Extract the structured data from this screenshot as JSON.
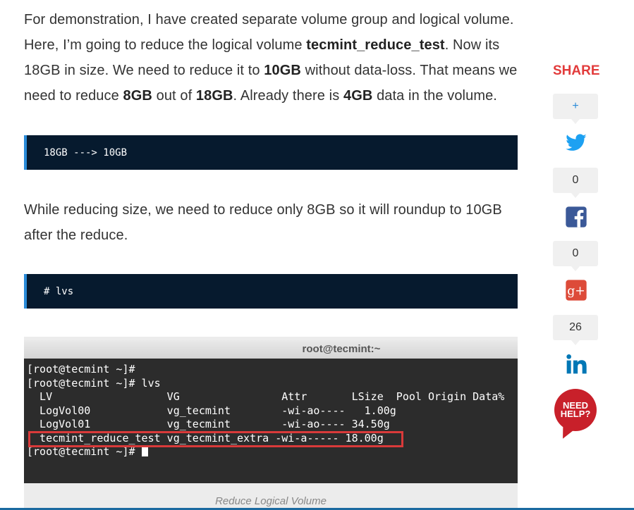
{
  "article": {
    "p1_a": "For demonstration, I have created separate volume group and logical volume. Here, I’m going to reduce the logical volume ",
    "p1_b": "tecmint_reduce_test",
    "p1_c": ". Now its 18GB in size. We need to reduce it to ",
    "p1_d": "10GB",
    "p1_e": " without data-loss. That means we need to reduce ",
    "p1_f": "8GB",
    "p1_g": " out of ",
    "p1_h": "18GB",
    "p1_i": ". Already there is ",
    "p1_j": "4GB",
    "p1_k": " data in the volume.",
    "code1": "18GB ---> 10GB",
    "p2": "While reducing size, we need to reduce only 8GB so it will roundup to 10GB after the reduce.",
    "code2": "# lvs"
  },
  "screenshot": {
    "title": "root@tecmint:~",
    "lines": [
      "[root@tecmint ~]#",
      "[root@tecmint ~]# lvs",
      "  LV                  VG                Attr       LSize  Pool Origin Data%",
      "  LogVol00            vg_tecmint        -wi-ao----   1.00g",
      "  LogVol01            vg_tecmint        -wi-ao---- 34.50g",
      "  tecmint_reduce_test vg_tecmint_extra -wi-a----- 18.00g"
    ],
    "prompt": "[root@tecmint ~]# ",
    "caption": "Reduce Logical Volume"
  },
  "share": {
    "title": "SHARE",
    "plus": "+",
    "twitter_count": "0",
    "facebook_count": "0",
    "googleplus_count": "26",
    "help_line1": "NEED",
    "help_line2": "HELP?"
  },
  "colors": {
    "code_bg": "#061a2e",
    "code_border": "#2a8bd8",
    "share_title": "#e23b3b",
    "twitter": "#1da1f2",
    "facebook": "#3b5998",
    "googleplus": "#dd4b39",
    "linkedin": "#0077b5",
    "help": "#c8202a",
    "highlight": "#d93a3a"
  }
}
